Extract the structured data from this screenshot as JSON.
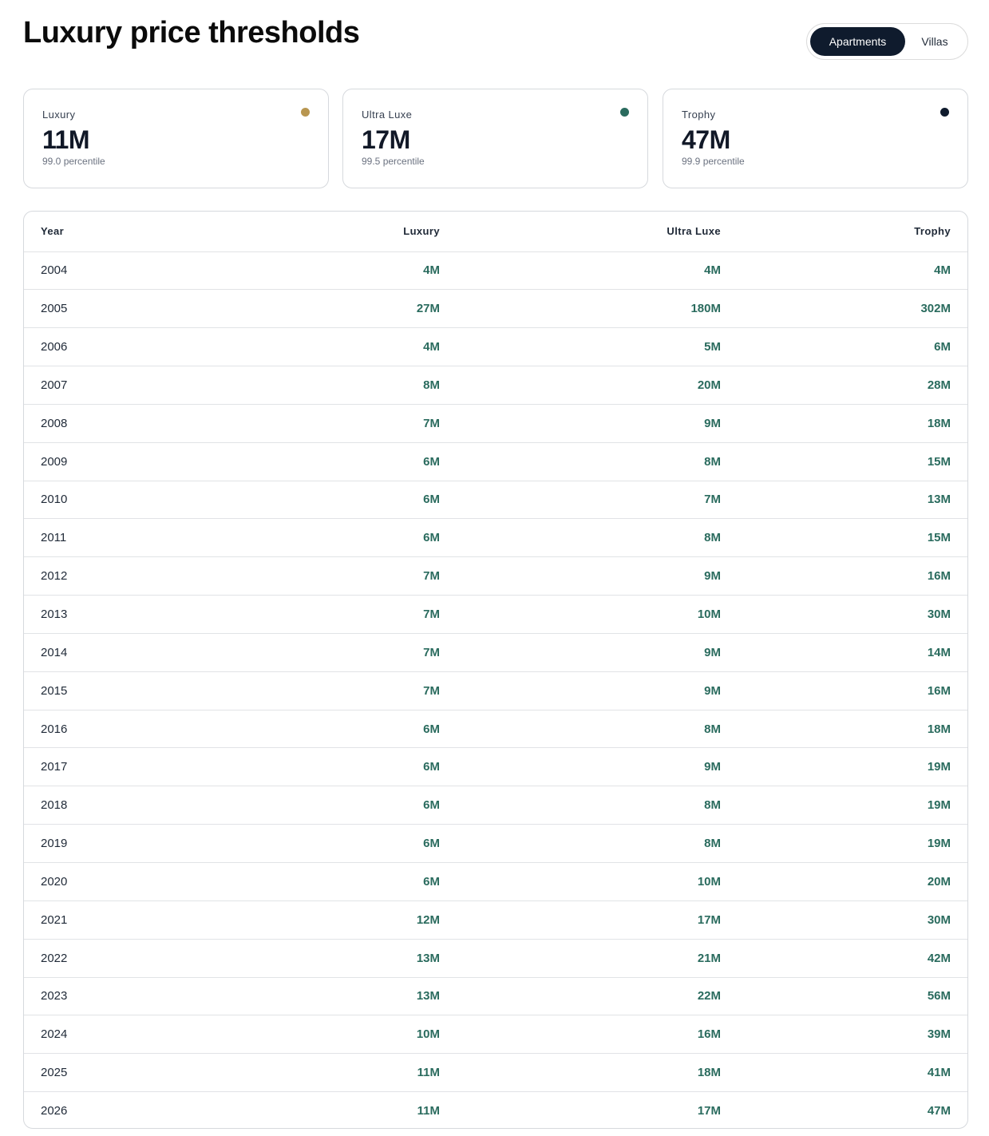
{
  "page": {
    "title": "Luxury price thresholds"
  },
  "toggle": {
    "options": [
      "Apartments",
      "Villas"
    ],
    "selected": "Apartments"
  },
  "colors": {
    "luxury": "#b89650",
    "ultra_luxe": "#2a6b5e",
    "trophy": "#0f1b2d",
    "value_text": "#2a6b5e"
  },
  "cards": [
    {
      "label": "Luxury",
      "value": "11M",
      "sub": "99.0 percentile",
      "dot_color": "#b89650"
    },
    {
      "label": "Ultra Luxe",
      "value": "17M",
      "sub": "99.5 percentile",
      "dot_color": "#2a6b5e"
    },
    {
      "label": "Trophy",
      "value": "47M",
      "sub": "99.9 percentile",
      "dot_color": "#0f1b2d"
    }
  ],
  "table": {
    "headers": [
      "Year",
      "Luxury",
      "Ultra Luxe",
      "Trophy"
    ],
    "rows": [
      [
        "2004",
        "4M",
        "4M",
        "4M"
      ],
      [
        "2005",
        "27M",
        "180M",
        "302M"
      ],
      [
        "2006",
        "4M",
        "5M",
        "6M"
      ],
      [
        "2007",
        "8M",
        "20M",
        "28M"
      ],
      [
        "2008",
        "7M",
        "9M",
        "18M"
      ],
      [
        "2009",
        "6M",
        "8M",
        "15M"
      ],
      [
        "2010",
        "6M",
        "7M",
        "13M"
      ],
      [
        "2011",
        "6M",
        "8M",
        "15M"
      ],
      [
        "2012",
        "7M",
        "9M",
        "16M"
      ],
      [
        "2013",
        "7M",
        "10M",
        "30M"
      ],
      [
        "2014",
        "7M",
        "9M",
        "14M"
      ],
      [
        "2015",
        "7M",
        "9M",
        "16M"
      ],
      [
        "2016",
        "6M",
        "8M",
        "18M"
      ],
      [
        "2017",
        "6M",
        "9M",
        "19M"
      ],
      [
        "2018",
        "6M",
        "8M",
        "19M"
      ],
      [
        "2019",
        "6M",
        "8M",
        "19M"
      ],
      [
        "2020",
        "6M",
        "10M",
        "20M"
      ],
      [
        "2021",
        "12M",
        "17M",
        "30M"
      ],
      [
        "2022",
        "13M",
        "21M",
        "42M"
      ],
      [
        "2023",
        "13M",
        "22M",
        "56M"
      ],
      [
        "2024",
        "10M",
        "16M",
        "39M"
      ],
      [
        "2025",
        "11M",
        "18M",
        "41M"
      ],
      [
        "2026",
        "11M",
        "17M",
        "47M"
      ]
    ]
  }
}
